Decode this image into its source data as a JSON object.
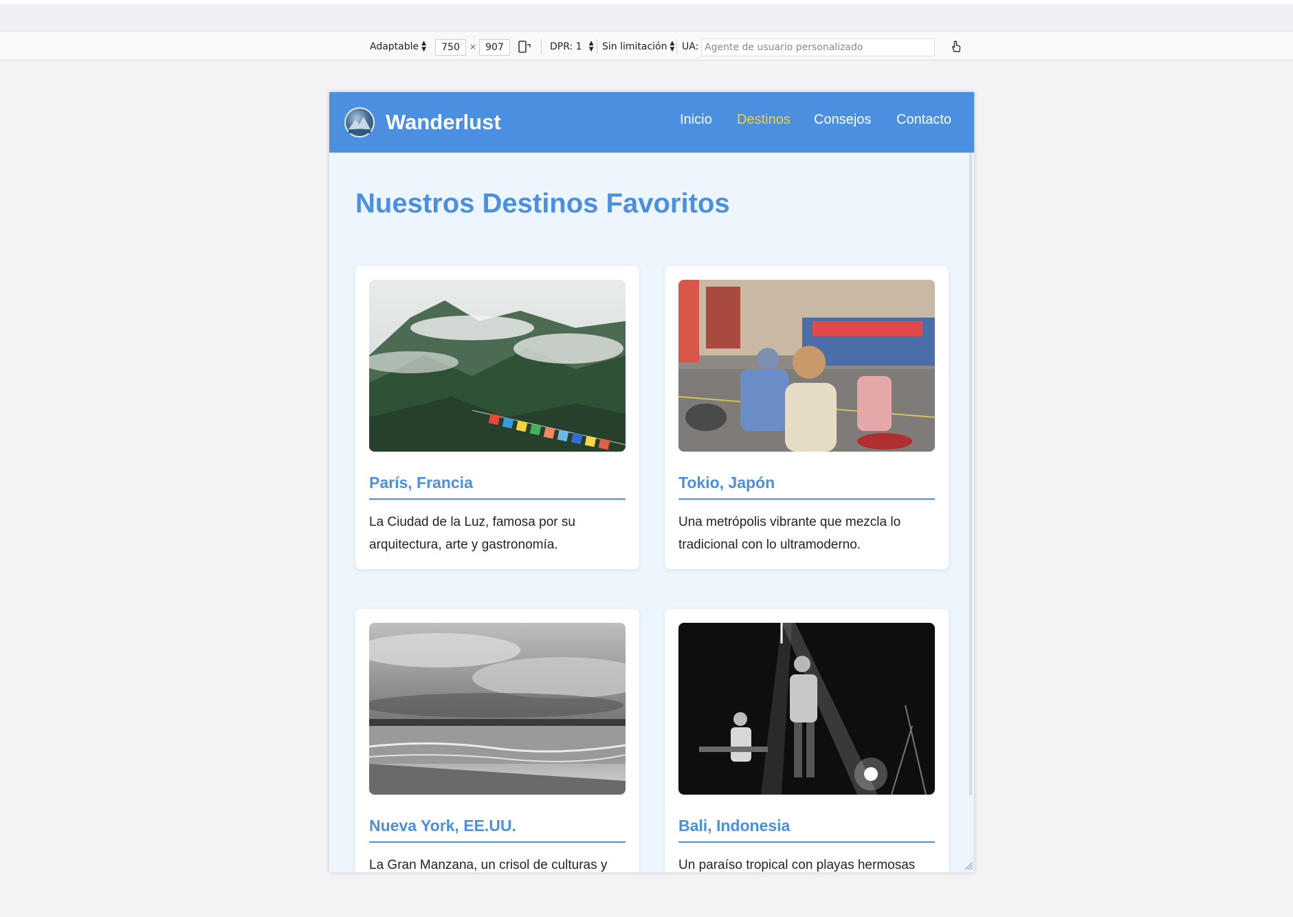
{
  "devtools": {
    "device_label": "Adaptable",
    "width_value": "750",
    "times_sign": "×",
    "height_value": "907",
    "dpr_label": "DPR: 1",
    "throttle_label": "Sin limitación",
    "ua_label": "UA:",
    "ua_placeholder": "Agente de usuario personalizado"
  },
  "site": {
    "brand": "Wanderlust",
    "nav": [
      {
        "label": "Inicio",
        "active": false
      },
      {
        "label": "Destinos",
        "active": true
      },
      {
        "label": "Consejos",
        "active": false
      },
      {
        "label": "Contacto",
        "active": false
      }
    ],
    "page_title": "Nuestros Destinos Favoritos",
    "destinations": [
      {
        "title": "París, Francia",
        "text": "La Ciudad de la Luz, famosa por su arquitectura, arte y gastronomía."
      },
      {
        "title": "Tokio, Japón",
        "text": "Una metrópolis vibrante que mezcla lo tradicional con lo ultramoderno."
      },
      {
        "title": "Nueva York, EE.UU.",
        "text": "La Gran Manzana, un crisol de culturas y"
      },
      {
        "title": "Bali, Indonesia",
        "text": "Un paraíso tropical con playas hermosas"
      }
    ]
  },
  "colors": {
    "accent": "#4a8fe0",
    "nav_active": "#f6cf3a",
    "page_bg": "#eef6fd",
    "card_bg": "#ffffff"
  },
  "icons": {
    "rotate": "rotate-device-icon",
    "touch": "touch-simulation-icon",
    "logo": "mountain-logo"
  }
}
